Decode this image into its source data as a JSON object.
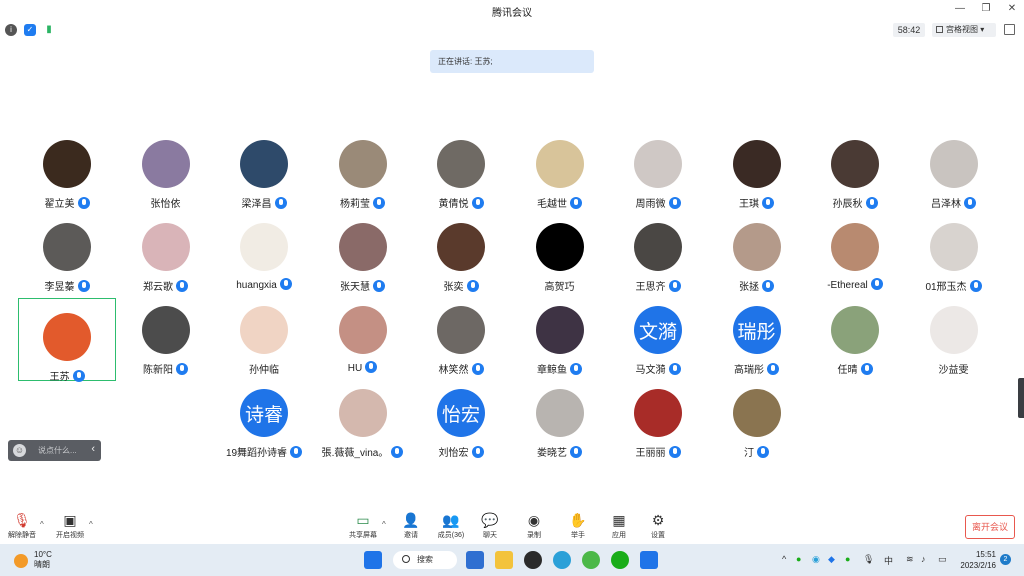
{
  "window": {
    "title": "腾讯会议"
  },
  "status": {
    "timer": "58:42",
    "view_mode": "宫格视图"
  },
  "speaking": "正在讲话: 王苏;",
  "participants": [
    {
      "name": "翟立美",
      "mic": true,
      "color": "#3b2a1e",
      "text": ""
    },
    {
      "name": "张怡依",
      "mic": false,
      "color": "#8a7aa0",
      "text": ""
    },
    {
      "name": "梁泽昌",
      "mic": true,
      "color": "#2e4a6a",
      "text": ""
    },
    {
      "name": "杨莉莹",
      "mic": true,
      "color": "#9a8a78",
      "text": ""
    },
    {
      "name": "黄倩悦",
      "mic": true,
      "color": "#6f6a64",
      "text": ""
    },
    {
      "name": "毛越世",
      "mic": true,
      "color": "#d8c49a",
      "text": ""
    },
    {
      "name": "周雨微",
      "mic": true,
      "color": "#cfc8c5",
      "text": ""
    },
    {
      "name": "王琪",
      "mic": true,
      "color": "#3a2a24",
      "text": ""
    },
    {
      "name": "孙辰秋",
      "mic": true,
      "color": "#4a3a34",
      "text": ""
    },
    {
      "name": "吕泽林",
      "mic": true,
      "color": "#c9c4c0",
      "text": ""
    },
    {
      "name": "李昱蓁",
      "mic": true,
      "color": "#5c5a58",
      "text": ""
    },
    {
      "name": "郑云歌",
      "mic": true,
      "color": "#d9b4b8",
      "text": ""
    },
    {
      "name": "huangxia",
      "mic": true,
      "color": "#f1ece4",
      "text": ""
    },
    {
      "name": "张天慧",
      "mic": true,
      "color": "#8a6a68",
      "text": ""
    },
    {
      "name": "张奕",
      "mic": true,
      "color": "#5a3a2c",
      "text": ""
    },
    {
      "name": "高贺巧",
      "mic": false,
      "color": "#000000",
      "text": ""
    },
    {
      "name": "王思齐",
      "mic": true,
      "color": "#4a4744",
      "text": ""
    },
    {
      "name": "张拯",
      "mic": true,
      "color": "#b49a8a",
      "text": ""
    },
    {
      "name": "-Ethereal",
      "mic": true,
      "color": "#b88a70",
      "text": ""
    },
    {
      "name": "01邢玉杰",
      "mic": true,
      "color": "#d8d3cf",
      "text": ""
    },
    {
      "name": "王苏",
      "mic": true,
      "color": "#e25a2c",
      "text": "",
      "active": true
    },
    {
      "name": "陈新阳",
      "mic": true,
      "color": "#4c4c4c",
      "text": ""
    },
    {
      "name": "孙仲临",
      "mic": false,
      "color": "#f0d4c4",
      "text": ""
    },
    {
      "name": "HU",
      "mic": true,
      "color": "#c49084",
      "text": ""
    },
    {
      "name": "林笑然",
      "mic": true,
      "color": "#6d6864",
      "text": ""
    },
    {
      "name": "章鲸鱼",
      "mic": true,
      "color": "#3e3344",
      "text": ""
    },
    {
      "name": "马文漪",
      "mic": true,
      "color": "#1f74e8",
      "text": "文漪"
    },
    {
      "name": "高瑞彤",
      "mic": true,
      "color": "#1f74e8",
      "text": "瑞彤"
    },
    {
      "name": "任晴",
      "mic": true,
      "color": "#8aa27a",
      "text": ""
    },
    {
      "name": "沙益雯",
      "mic": false,
      "color": "#ece8e6",
      "text": ""
    },
    {
      "name": "19舞蹈孙诗睿",
      "mic": true,
      "color": "#1f74e8",
      "text": "诗睿"
    },
    {
      "name": "張.薇薇_vina。",
      "mic": true,
      "color": "#d4b8ae",
      "text": ""
    },
    {
      "name": "刘怡宏",
      "mic": true,
      "color": "#1f74e8",
      "text": "怡宏"
    },
    {
      "name": "娄晓艺",
      "mic": true,
      "color": "#b8b4b0",
      "text": ""
    },
    {
      "name": "王丽丽",
      "mic": true,
      "color": "#a82c28",
      "text": ""
    },
    {
      "name": "汀",
      "mic": true,
      "color": "#8a7450",
      "text": ""
    }
  ],
  "chat": {
    "placeholder": "说点什么..."
  },
  "toolbar": {
    "unmute": "解除静音",
    "start_video": "开启视频",
    "share": "共享屏幕",
    "invite": "邀请",
    "members": "成员(36)",
    "chat": "聊天",
    "record": "录制",
    "raise_hand": "举手",
    "apps": "应用",
    "settings": "设置",
    "leave": "离开会议"
  },
  "taskbar": {
    "temp": "10°C",
    "weather": "晴朗",
    "search": "搜索",
    "ime": "中",
    "time": "15:51",
    "date": "2023/2/16",
    "notifications": "2"
  }
}
